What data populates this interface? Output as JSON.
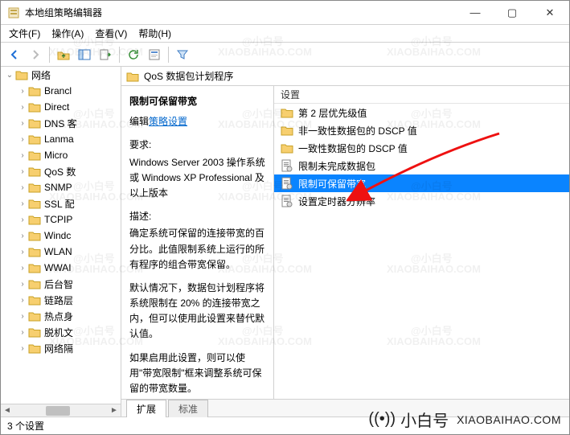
{
  "window": {
    "title": "本地组策略编辑器"
  },
  "menubar": {
    "file": "文件(F)",
    "action": "操作(A)",
    "view": "查看(V)",
    "help": "帮助(H)"
  },
  "tree": {
    "root": {
      "label": "网络"
    },
    "items": [
      {
        "label": "Brancl"
      },
      {
        "label": "Direct"
      },
      {
        "label": "DNS 客"
      },
      {
        "label": "Lanma"
      },
      {
        "label": "Micro"
      },
      {
        "label": "QoS 数"
      },
      {
        "label": "SNMP"
      },
      {
        "label": "SSL 配"
      },
      {
        "label": "TCPIP"
      },
      {
        "label": "Windc"
      },
      {
        "label": "WLAN"
      },
      {
        "label": "WWAI"
      },
      {
        "label": "后台智"
      },
      {
        "label": "链路层"
      },
      {
        "label": "热点身"
      },
      {
        "label": "脱机文"
      },
      {
        "label": "网络隔"
      }
    ]
  },
  "content": {
    "header_title": "QoS 数据包计划程序"
  },
  "description": {
    "setting_name": "限制可保留带宽",
    "edit_prefix": "编辑",
    "edit_link": "策略设置",
    "req_label": "要求:",
    "req_text": "Windows Server 2003 操作系统或 Windows XP Professional 及以上版本",
    "desc_label": "描述:",
    "desc_p1": "确定系统可保留的连接带宽的百分比。此值限制系统上运行的所有程序的组合带宽保留。",
    "desc_p2": "默认情况下，数据包计划程序将系统限制在 20% 的连接带宽之内，但可以使用此设置来替代默认值。",
    "desc_p3": "如果启用此设置，则可以使用\"带宽限制\"框来调整系统可保留的带宽数量。"
  },
  "list": {
    "column_header": "设置",
    "rows": [
      {
        "type": "folder",
        "label": "第 2 层优先级值"
      },
      {
        "type": "folder",
        "label": "非一致性数据包的 DSCP 值"
      },
      {
        "type": "folder",
        "label": "一致性数据包的 DSCP 值"
      },
      {
        "type": "setting",
        "label": "限制未完成数据包"
      },
      {
        "type": "setting",
        "label": "限制可保留带宽",
        "selected": true
      },
      {
        "type": "setting",
        "label": "设置定时器分辨率"
      }
    ]
  },
  "tabs": {
    "extended": "扩展",
    "standard": "标准"
  },
  "statusbar": {
    "text": "3 个设置"
  },
  "watermark": {
    "line1": "@小白号",
    "line2": "XIAOBAIHAO.COM",
    "brand_cn": "小白号",
    "brand_en": "XIAOBAIHAO.COM"
  }
}
